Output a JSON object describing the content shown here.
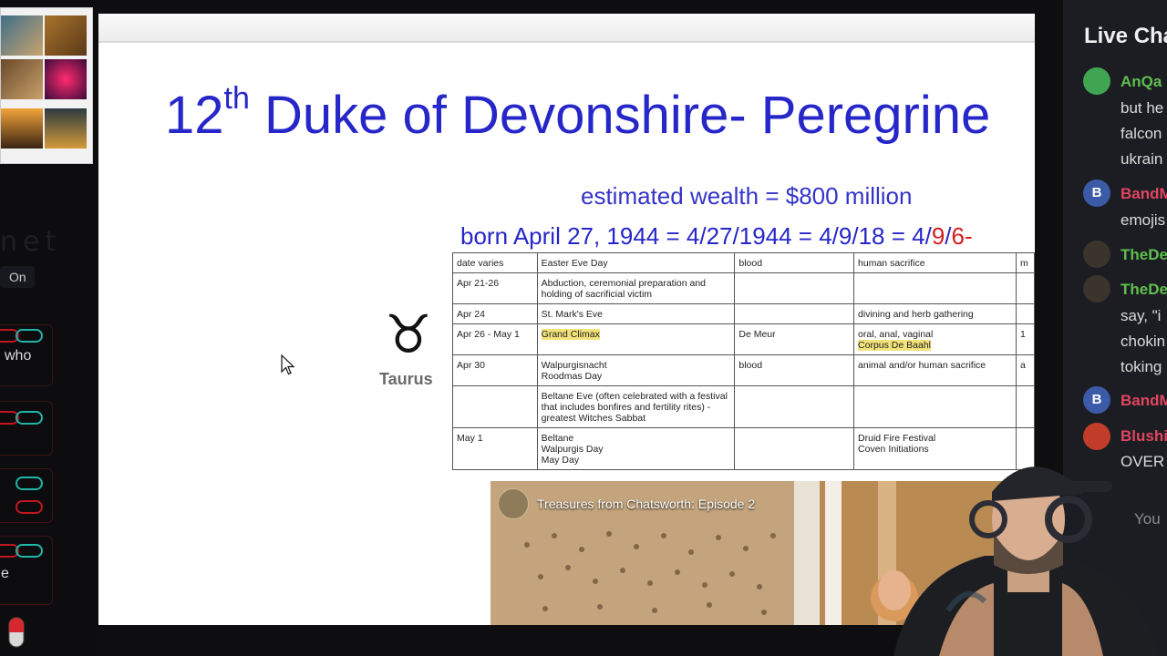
{
  "slide": {
    "title_main": "12",
    "title_sup": "th",
    "title_rest": " Duke of Devonshire- Peregrine",
    "wealth": "estimated wealth = $800 million",
    "born_prefix": "born April 27, 1944 = 4/27/1944 = 4/9/18 = 4/",
    "born_red1": "9",
    "born_sep": "/",
    "born_red2": "6-",
    "zodiac_label": "Taurus",
    "table": {
      "header": [
        "date varies",
        "Easter Eve Day",
        "blood",
        "human sacrifice",
        "m"
      ],
      "rows": [
        [
          "Apr 21-26",
          "Abduction, ceremonial preparation and holding of sacrificial victim",
          "",
          "",
          ""
        ],
        [
          "Apr 24",
          "St. Mark's Eve",
          "",
          "divining and herb gathering",
          ""
        ],
        [
          "Apr 26 - May 1",
          "Grand Climax",
          "De Meur",
          "oral, anal, vaginal",
          "1"
        ],
        [
          "Apr 30",
          "Walpurgisnacht",
          "blood",
          "animal and/or human sacrifice",
          "a"
        ],
        [
          "",
          "Beltane Eve (often celebrated with a festival that includes bonfires and fertility rites) - greatest Witches Sabbat",
          "",
          "",
          ""
        ],
        [
          "May 1",
          "Beltane",
          "",
          "Druid Fire Festival",
          ""
        ]
      ],
      "extra": {
        "corpus": "Corpus De Baahl",
        "roodmas": "Roodmas Day",
        "walpurgis_day": "Walpurgis Day",
        "may_day": "May Day",
        "coven": "Coven Initiations"
      }
    }
  },
  "video": {
    "title": "Treasures from Chatsworth: Episode 2"
  },
  "left_panel": {
    "net_text": "net",
    "on_label": "On",
    "card_texts": [
      "who",
      "e"
    ]
  },
  "chat": {
    "title": "Live Chat",
    "messages": [
      {
        "name": "AnQa",
        "name_color": "#5fbf4f",
        "lines": [
          "but he",
          "falcon",
          "ukrain"
        ]
      },
      {
        "name": "BandM",
        "name_color": "#e04561",
        "lines": [
          "emojis"
        ]
      },
      {
        "name": "TheDe",
        "name_color": "#5fbf4f",
        "lines": []
      },
      {
        "name": "TheDe",
        "name_color": "#5fbf4f",
        "lines": [
          "say, \"i",
          "chokin",
          "toking"
        ]
      },
      {
        "name": "BandM",
        "name_color": "#e04561",
        "lines": []
      },
      {
        "name": "Blushi",
        "name_color": "#e04561",
        "lines": [
          "OVER"
        ]
      }
    ],
    "input_placeholder": "You"
  },
  "colors": {
    "title_blue": "#2626c9",
    "highlight": "#f2e27a",
    "chat_bg": "#1c1d22"
  }
}
